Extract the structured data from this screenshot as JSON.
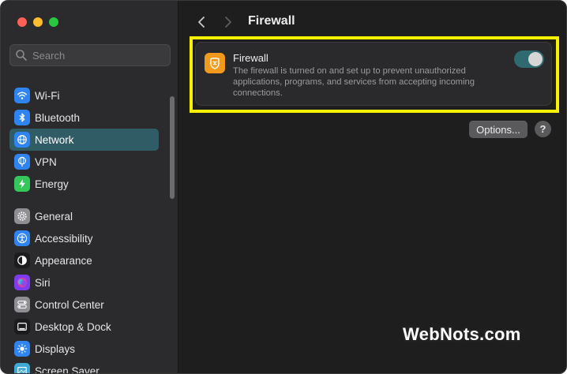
{
  "window": {
    "title": "Firewall"
  },
  "search": {
    "placeholder": "Search"
  },
  "sidebar": {
    "groups": [
      [
        {
          "label": "Wi-Fi",
          "icon": "wifi-icon",
          "color": "#2f84f2"
        },
        {
          "label": "Bluetooth",
          "icon": "bluetooth-icon",
          "color": "#2f84f2"
        },
        {
          "label": "Network",
          "icon": "globe-icon",
          "color": "#2f84f2",
          "selected": true
        },
        {
          "label": "VPN",
          "icon": "vpn-globe-icon",
          "color": "#2f84f2"
        },
        {
          "label": "Energy",
          "icon": "lightning-icon",
          "color": "#34c759"
        }
      ],
      [
        {
          "label": "General",
          "icon": "gear-icon",
          "color": "#8e8e93"
        },
        {
          "label": "Accessibility",
          "icon": "accessibility-icon",
          "color": "#2f84f2"
        },
        {
          "label": "Appearance",
          "icon": "appearance-icon",
          "color": "#1c1c1e"
        },
        {
          "label": "Siri",
          "icon": "siri-icon",
          "color": "#7d3cf0"
        },
        {
          "label": "Control Center",
          "icon": "control-center-icon",
          "color": "#8e8e93"
        },
        {
          "label": "Desktop & Dock",
          "icon": "dock-icon",
          "color": "#1c1c1e"
        },
        {
          "label": "Displays",
          "icon": "sun-icon",
          "color": "#2f84f2"
        },
        {
          "label": "Screen Saver",
          "icon": "screensaver-icon",
          "color": "#3fa9d8"
        }
      ]
    ]
  },
  "firewall": {
    "title": "Firewall",
    "description": "The firewall is turned on and set up to prevent unauthorized applications, programs, and services from accepting incoming connections.",
    "enabled": true,
    "icon_color": "#f39a1c",
    "toggle_color": "#2f6a70"
  },
  "actions": {
    "options_label": "Options...",
    "help_label": "?"
  },
  "watermark": {
    "text": "WebNots.com"
  },
  "colors": {
    "highlight": "#f7f100",
    "selected_bg": "#305c66"
  }
}
